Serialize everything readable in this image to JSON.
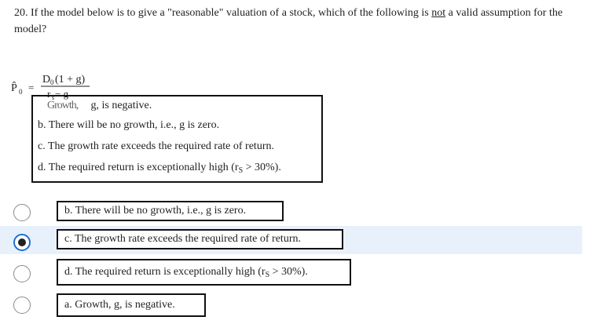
{
  "question": {
    "prefix": "20. If the model below is to give a \"reasonable\" valuation of a stock, which of the following is ",
    "emphasis": "not",
    "suffix": " a valid assumption for the model?"
  },
  "formula": {
    "lhs": "P̂",
    "lhs_sub": "0",
    "equals": "=",
    "numerator_d": "D",
    "numerator_d_sub": "0",
    "numerator_rest": "(1 + g)",
    "denominator_r": "r",
    "denominator_r_sub": "s",
    "denominator_rest": " − g"
  },
  "stem_choices": {
    "a_partial_hidden": "Growth,",
    "a_partial_visible": " g, is negative.",
    "b": "b. There will be no growth, i.e., g is zero.",
    "c": "c. The growth rate exceeds the required rate of return.",
    "d_prefix": "d. The required return is exceptionally high (r",
    "d_sub": "S",
    "d_suffix": " > 30%)."
  },
  "answers": [
    {
      "label": "b. There will be no growth, i.e., g is zero.",
      "selected": false
    },
    {
      "label": "c. The growth rate exceeds the required rate of return.",
      "selected": true
    },
    {
      "label_prefix": "d. The required return is exceptionally high (r",
      "label_sub": "S",
      "label_suffix": " > 30%).",
      "selected": false
    },
    {
      "label": "a. Growth, g, is negative.",
      "selected": false
    }
  ]
}
